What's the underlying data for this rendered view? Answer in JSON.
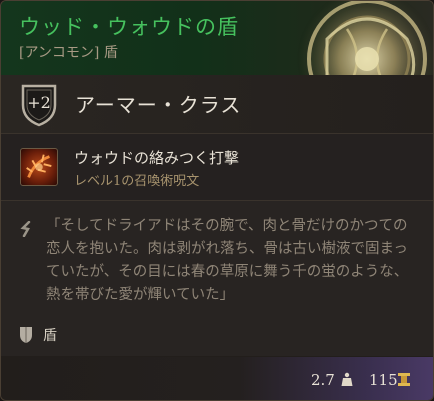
{
  "item": {
    "name": "ウッド・ウォウドの盾",
    "rarity_type": "[アンコモン] 盾",
    "rarity_color": "#46c15e"
  },
  "armor_class": {
    "value": "+2",
    "label": "アーマー・クラス"
  },
  "spell": {
    "name": "ウォウドの絡みつく打撃",
    "subtitle": "レベル1の召喚術呪文",
    "icon": "thorn-strike-icon"
  },
  "flavor_text": "「そしてドライアドはその腕で、肉と骨だけのかつての恋人を抱いた。肉は剥がれ落ち、骨は古い樹液で固まっていたが、その目には春の草原に舞う千の蛍のような、熱を帯びた愛が輝いていた」",
  "tag": {
    "label": "盾",
    "icon": "shield-tag-icon"
  },
  "footer": {
    "weight": "2.7",
    "weight_icon": "weight-icon",
    "value": "115",
    "value_icon": "gold-icon"
  }
}
